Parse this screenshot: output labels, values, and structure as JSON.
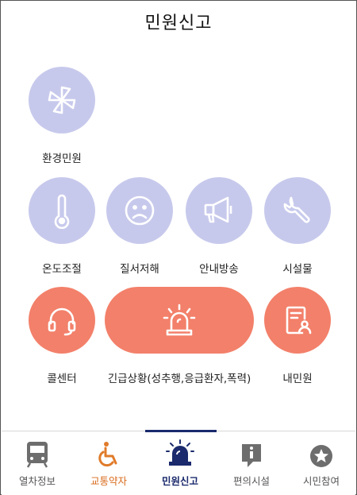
{
  "header": {
    "title": "민원신고"
  },
  "categories": {
    "environment": "환경민원",
    "temperature": "온도조절",
    "order": "질서저해",
    "broadcast": "안내방송",
    "facility": "시설물",
    "call_center": "콜센터",
    "emergency": "긴급상황(성추행,응급환자,폭력)",
    "my_complaints": "내민원"
  },
  "colors": {
    "purple": "#c7c9ec",
    "salmon": "#f3806a",
    "navy": "#1a2a6c",
    "orange": "#d86a1a"
  },
  "tabs": [
    {
      "label": "열차정보",
      "icon": "train-icon"
    },
    {
      "label": "교통약자",
      "icon": "wheelchair-icon"
    },
    {
      "label": "민원신고",
      "icon": "siren-icon",
      "active": true
    },
    {
      "label": "편의시설",
      "icon": "info-icon"
    },
    {
      "label": "시민참여",
      "icon": "star-icon"
    }
  ]
}
